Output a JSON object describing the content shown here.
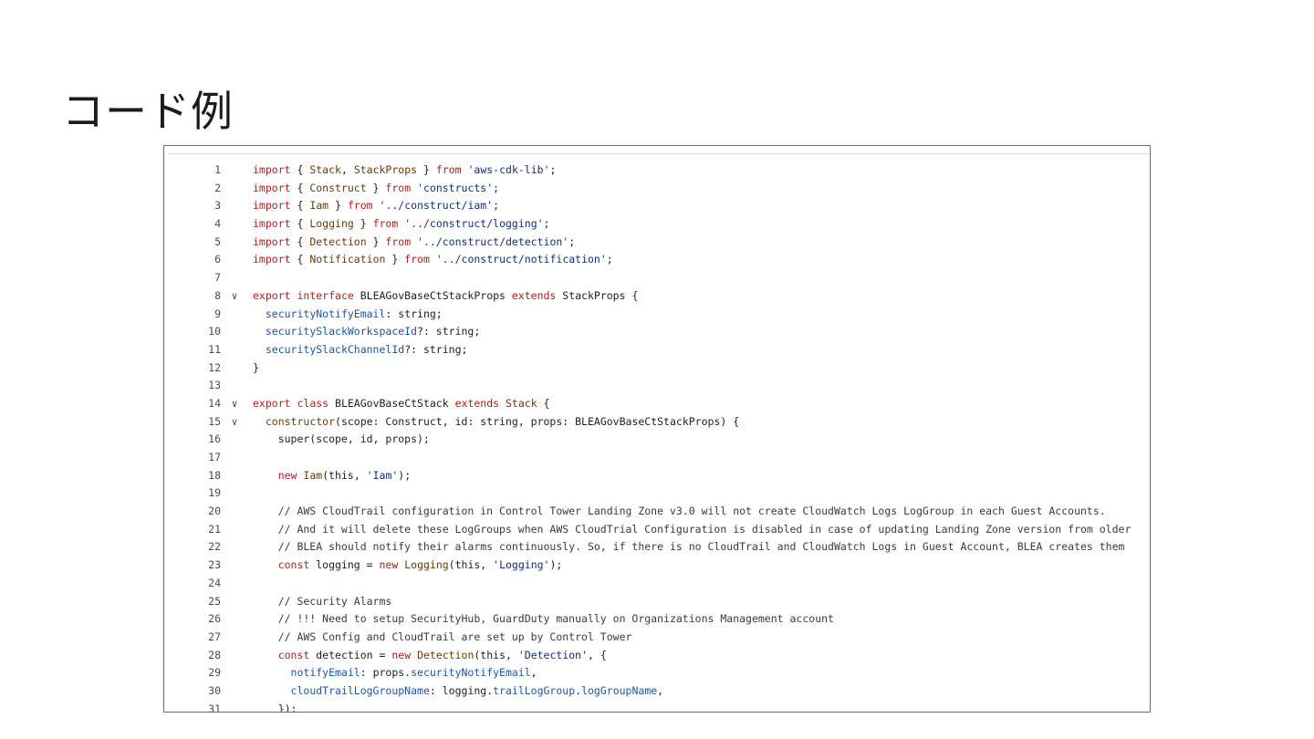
{
  "slide": {
    "title": "コード例"
  },
  "code": {
    "lines": [
      {
        "n": "1",
        "fold": false,
        "tokens": [
          {
            "t": "import",
            "c": "kw"
          },
          {
            "t": " { ",
            "c": ""
          },
          {
            "t": "Stack",
            "c": "ident"
          },
          {
            "t": ", ",
            "c": ""
          },
          {
            "t": "StackProps",
            "c": "ident"
          },
          {
            "t": " } ",
            "c": ""
          },
          {
            "t": "from",
            "c": "kw"
          },
          {
            "t": " ",
            "c": ""
          },
          {
            "t": "'aws-cdk-lib'",
            "c": "str"
          },
          {
            "t": ";",
            "c": ""
          }
        ]
      },
      {
        "n": "2",
        "fold": false,
        "tokens": [
          {
            "t": "import",
            "c": "kw"
          },
          {
            "t": " { ",
            "c": ""
          },
          {
            "t": "Construct",
            "c": "ident"
          },
          {
            "t": " } ",
            "c": ""
          },
          {
            "t": "from",
            "c": "kw"
          },
          {
            "t": " ",
            "c": ""
          },
          {
            "t": "'constructs'",
            "c": "str"
          },
          {
            "t": ";",
            "c": ""
          }
        ]
      },
      {
        "n": "3",
        "fold": false,
        "tokens": [
          {
            "t": "import",
            "c": "kw"
          },
          {
            "t": " { ",
            "c": ""
          },
          {
            "t": "Iam",
            "c": "ident"
          },
          {
            "t": " } ",
            "c": ""
          },
          {
            "t": "from",
            "c": "kw"
          },
          {
            "t": " ",
            "c": ""
          },
          {
            "t": "'../construct/iam'",
            "c": "str"
          },
          {
            "t": ";",
            "c": ""
          }
        ]
      },
      {
        "n": "4",
        "fold": false,
        "tokens": [
          {
            "t": "import",
            "c": "kw"
          },
          {
            "t": " { ",
            "c": ""
          },
          {
            "t": "Logging",
            "c": "ident"
          },
          {
            "t": " } ",
            "c": ""
          },
          {
            "t": "from",
            "c": "kw"
          },
          {
            "t": " ",
            "c": ""
          },
          {
            "t": "'../construct/logging'",
            "c": "str"
          },
          {
            "t": ";",
            "c": ""
          }
        ]
      },
      {
        "n": "5",
        "fold": false,
        "tokens": [
          {
            "t": "import",
            "c": "kw"
          },
          {
            "t": " { ",
            "c": ""
          },
          {
            "t": "Detection",
            "c": "ident"
          },
          {
            "t": " } ",
            "c": ""
          },
          {
            "t": "from",
            "c": "kw"
          },
          {
            "t": " ",
            "c": ""
          },
          {
            "t": "'../construct/detection'",
            "c": "str"
          },
          {
            "t": ";",
            "c": ""
          }
        ]
      },
      {
        "n": "6",
        "fold": false,
        "tokens": [
          {
            "t": "import",
            "c": "kw"
          },
          {
            "t": " { ",
            "c": ""
          },
          {
            "t": "Notification",
            "c": "ident"
          },
          {
            "t": " } ",
            "c": ""
          },
          {
            "t": "from",
            "c": "kw"
          },
          {
            "t": " ",
            "c": ""
          },
          {
            "t": "'../construct/notification'",
            "c": "str"
          },
          {
            "t": ";",
            "c": ""
          }
        ]
      },
      {
        "n": "7",
        "fold": false,
        "tokens": []
      },
      {
        "n": "8",
        "fold": true,
        "tokens": [
          {
            "t": "export",
            "c": "kw"
          },
          {
            "t": " ",
            "c": ""
          },
          {
            "t": "interface",
            "c": "kw"
          },
          {
            "t": " BLEAGovBaseCtStackProps ",
            "c": ""
          },
          {
            "t": "extends",
            "c": "kw"
          },
          {
            "t": " StackProps {",
            "c": ""
          }
        ]
      },
      {
        "n": "9",
        "fold": false,
        "tokens": [
          {
            "t": "  ",
            "c": ""
          },
          {
            "t": "securityNotifyEmail",
            "c": "prop"
          },
          {
            "t": ": string;",
            "c": ""
          }
        ]
      },
      {
        "n": "10",
        "fold": false,
        "tokens": [
          {
            "t": "  ",
            "c": ""
          },
          {
            "t": "securitySlackWorkspaceId",
            "c": "prop"
          },
          {
            "t": "?: string;",
            "c": ""
          }
        ]
      },
      {
        "n": "11",
        "fold": false,
        "tokens": [
          {
            "t": "  ",
            "c": ""
          },
          {
            "t": "securitySlackChannelId",
            "c": "prop"
          },
          {
            "t": "?: string;",
            "c": ""
          }
        ]
      },
      {
        "n": "12",
        "fold": false,
        "tokens": [
          {
            "t": "}",
            "c": ""
          }
        ]
      },
      {
        "n": "13",
        "fold": false,
        "tokens": []
      },
      {
        "n": "14",
        "fold": true,
        "tokens": [
          {
            "t": "export",
            "c": "kw"
          },
          {
            "t": " ",
            "c": ""
          },
          {
            "t": "class",
            "c": "kw"
          },
          {
            "t": " BLEAGovBaseCtStack ",
            "c": ""
          },
          {
            "t": "extends",
            "c": "kw"
          },
          {
            "t": " ",
            "c": ""
          },
          {
            "t": "Stack",
            "c": "ident"
          },
          {
            "t": " {",
            "c": ""
          }
        ]
      },
      {
        "n": "15",
        "fold": true,
        "tokens": [
          {
            "t": "  ",
            "c": ""
          },
          {
            "t": "constructor",
            "c": "ident"
          },
          {
            "t": "(scope: Construct, id: string, props: BLEAGovBaseCtStackProps) {",
            "c": ""
          }
        ]
      },
      {
        "n": "16",
        "fold": false,
        "tokens": [
          {
            "t": "    super(scope, id, props);",
            "c": ""
          }
        ]
      },
      {
        "n": "17",
        "fold": false,
        "tokens": []
      },
      {
        "n": "18",
        "fold": false,
        "tokens": [
          {
            "t": "    ",
            "c": ""
          },
          {
            "t": "new",
            "c": "kw"
          },
          {
            "t": " ",
            "c": ""
          },
          {
            "t": "Iam",
            "c": "ident"
          },
          {
            "t": "(this, ",
            "c": ""
          },
          {
            "t": "'Iam'",
            "c": "str"
          },
          {
            "t": ");",
            "c": ""
          }
        ]
      },
      {
        "n": "19",
        "fold": false,
        "tokens": []
      },
      {
        "n": "20",
        "fold": false,
        "tokens": [
          {
            "t": "    // AWS CloudTrail configuration in Control Tower Landing Zone v3.0 will not create CloudWatch Logs LogGroup in each Guest Accounts.",
            "c": "cm"
          }
        ]
      },
      {
        "n": "21",
        "fold": false,
        "tokens": [
          {
            "t": "    // And it will delete these LogGroups when AWS CloudTrial Configuration is disabled in case of updating Landing Zone version from older",
            "c": "cm"
          }
        ]
      },
      {
        "n": "22",
        "fold": false,
        "tokens": [
          {
            "t": "    // BLEA should notify their alarms continuously. So, if there is no CloudTrail and CloudWatch Logs in Guest Account, BLEA creates them",
            "c": "cm"
          }
        ]
      },
      {
        "n": "23",
        "fold": false,
        "tokens": [
          {
            "t": "    ",
            "c": ""
          },
          {
            "t": "const",
            "c": "kw"
          },
          {
            "t": " logging = ",
            "c": ""
          },
          {
            "t": "new",
            "c": "kw"
          },
          {
            "t": " ",
            "c": ""
          },
          {
            "t": "Logging",
            "c": "ident"
          },
          {
            "t": "(this, ",
            "c": ""
          },
          {
            "t": "'Logging'",
            "c": "str"
          },
          {
            "t": ");",
            "c": ""
          }
        ]
      },
      {
        "n": "24",
        "fold": false,
        "tokens": []
      },
      {
        "n": "25",
        "fold": false,
        "tokens": [
          {
            "t": "    // Security Alarms",
            "c": "cm"
          }
        ]
      },
      {
        "n": "26",
        "fold": false,
        "tokens": [
          {
            "t": "    // !!! Need to setup SecurityHub, GuardDuty manually on Organizations Management account",
            "c": "cm"
          }
        ]
      },
      {
        "n": "27",
        "fold": false,
        "tokens": [
          {
            "t": "    // AWS Config and CloudTrail are set up by Control Tower",
            "c": "cm"
          }
        ]
      },
      {
        "n": "28",
        "fold": false,
        "tokens": [
          {
            "t": "    ",
            "c": ""
          },
          {
            "t": "const",
            "c": "kw"
          },
          {
            "t": " detection = ",
            "c": ""
          },
          {
            "t": "new",
            "c": "kw"
          },
          {
            "t": " ",
            "c": ""
          },
          {
            "t": "Detection",
            "c": "ident"
          },
          {
            "t": "(this, ",
            "c": ""
          },
          {
            "t": "'Detection'",
            "c": "str"
          },
          {
            "t": ", {",
            "c": ""
          }
        ]
      },
      {
        "n": "29",
        "fold": false,
        "tokens": [
          {
            "t": "      ",
            "c": ""
          },
          {
            "t": "notifyEmail",
            "c": "prop"
          },
          {
            "t": ": props.",
            "c": ""
          },
          {
            "t": "securityNotifyEmail",
            "c": "prop"
          },
          {
            "t": ",",
            "c": ""
          }
        ]
      },
      {
        "n": "30",
        "fold": false,
        "tokens": [
          {
            "t": "      ",
            "c": ""
          },
          {
            "t": "cloudTrailLogGroupName",
            "c": "prop"
          },
          {
            "t": ": logging.",
            "c": ""
          },
          {
            "t": "trailLogGroup",
            "c": "prop"
          },
          {
            "t": ".",
            "c": ""
          },
          {
            "t": "logGroupName",
            "c": "prop"
          },
          {
            "t": ",",
            "c": ""
          }
        ]
      },
      {
        "n": "31",
        "fold": false,
        "tokens": [
          {
            "t": "    });",
            "c": ""
          }
        ]
      }
    ]
  }
}
